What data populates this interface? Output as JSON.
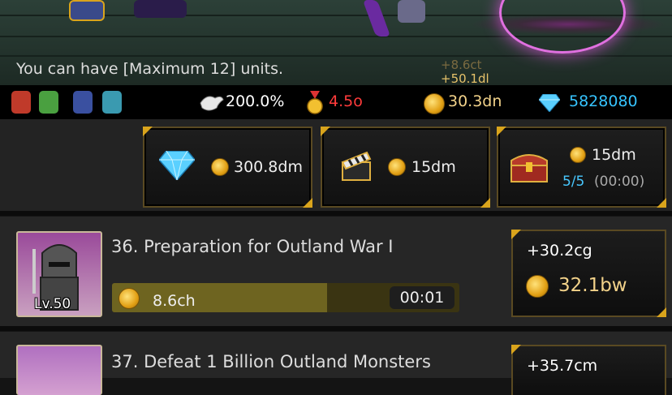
{
  "battle": {
    "unit_limit_text": "You can have [Maximum 12] units.",
    "floating_gain_1": "+8.6ct",
    "floating_gain_2": "+50.1dl"
  },
  "status_bar": {
    "speed_multiplier": "200.0%",
    "medal_value": "4.5o",
    "gold": "30.3dn",
    "gems": "5828080",
    "colors": {
      "medal": "#ff3b3b",
      "gems": "#36c4ff",
      "gold": "#f2d28a"
    }
  },
  "shop": {
    "gem_pack_price": "300.8dm",
    "clapper_price": "15dm",
    "chest_price": "15dm",
    "chest_count": "5/5",
    "chest_timer": "(00:00)"
  },
  "quests": [
    {
      "title": "36. Preparation for Outland War I",
      "level": "Lv.50",
      "cost": "8.6ch",
      "timer": "00:01",
      "progress": 0.62,
      "reward_gain": "+30.2cg",
      "reward_price": "32.1bw"
    },
    {
      "title": "37. Defeat 1 Billion Outland Monsters",
      "reward_gain": "+35.7cm"
    }
  ]
}
